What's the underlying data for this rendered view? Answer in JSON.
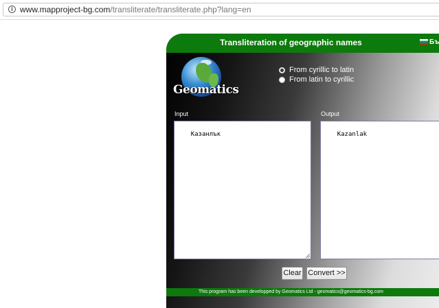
{
  "browser": {
    "url_host": "www.mapproject-bg.com",
    "url_path": "/transliterate/transliterate.php?lang=en"
  },
  "app": {
    "title": "Transliteration of geographic names",
    "lang_switch": "Бъ",
    "logo_text": "Geomatics",
    "options": [
      {
        "label": "From cyrillic to latin",
        "selected": true
      },
      {
        "label": "From latin to cyrillic",
        "selected": false
      }
    ],
    "input_label": "Input",
    "input_value": "Казанлък",
    "output_label": "Output",
    "output_value": "Kazanlak",
    "clear_label": "Clear",
    "convert_label": "Convert >>",
    "footer": "This program has been developped by Geomatics Ltd - geomatics@geomatics-bg.com"
  }
}
